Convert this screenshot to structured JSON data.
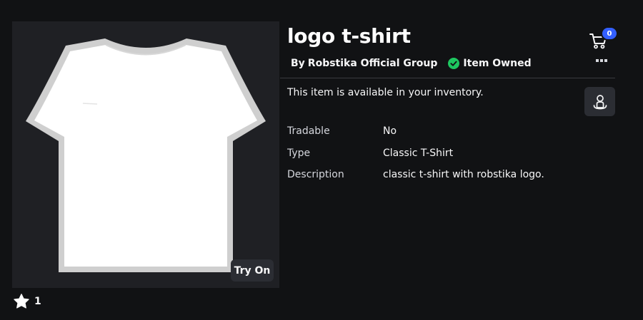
{
  "item": {
    "title": "logo t-shirt",
    "by_label": "By",
    "creator": "Robstika Official Group",
    "owned_label": "Item Owned",
    "availability_text": "This item is available in your inventory.",
    "try_on_label": "Try On",
    "favorites_count": "1"
  },
  "cart": {
    "count": "0"
  },
  "details": [
    {
      "key": "Tradable",
      "value": "No"
    },
    {
      "key": "Type",
      "value": "Classic T-Shirt"
    },
    {
      "key": "Description",
      "value": "classic t-shirt with robstika logo."
    }
  ],
  "icons": {
    "cart": "cart-icon",
    "more": "more-horizontal-icon",
    "owned": "check-circle-icon",
    "favorite": "star-icon",
    "avatar": "avatar-icon"
  },
  "colors": {
    "background": "#111214",
    "panel": "#1f2024",
    "button": "#2b2d33",
    "owned_check": "#1ec760",
    "badge": "#335fff"
  }
}
